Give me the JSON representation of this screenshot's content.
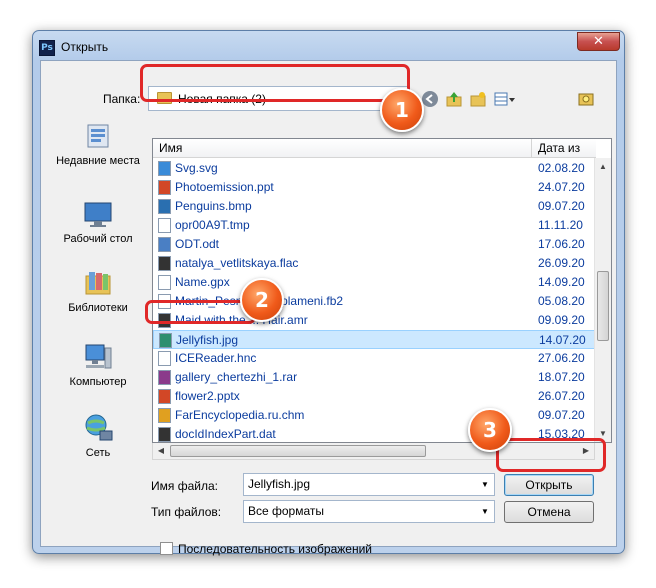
{
  "window": {
    "title": "Открыть",
    "app_icon": "Ps",
    "close_glyph": "✕"
  },
  "folder": {
    "label": "Папка:",
    "value": "Новая папка (2)"
  },
  "toolbar": {
    "back_icon": "back-icon",
    "up_icon": "up-folder-icon",
    "new_folder_icon": "new-folder-icon",
    "view_icon": "view-menu-icon"
  },
  "places": [
    {
      "label": "Недавние места",
      "icon": "recent-places-icon"
    },
    {
      "label": "Рабочий стол",
      "icon": "desktop-icon"
    },
    {
      "label": "Библиотеки",
      "icon": "libraries-icon"
    },
    {
      "label": "Компьютер",
      "icon": "computer-icon"
    },
    {
      "label": "Сеть",
      "icon": "network-icon"
    }
  ],
  "columns": {
    "name": "Имя",
    "date": "Дата из"
  },
  "files": [
    {
      "name": "Svg.svg",
      "date": "02.08.20",
      "color": "#3a8bd8"
    },
    {
      "name": "Photoemission.ppt",
      "date": "24.07.20",
      "color": "#d24726"
    },
    {
      "name": "Penguins.bmp",
      "date": "09.07.20",
      "color": "#2a6fb0"
    },
    {
      "name": "opr00A9T.tmp",
      "date": "11.11.20",
      "color": "#ffffff"
    },
    {
      "name": "ODT.odt",
      "date": "17.06.20",
      "color": "#4a7fc4"
    },
    {
      "name": "natalya_vetlitskaya.flac",
      "date": "26.09.20",
      "color": "#333333"
    },
    {
      "name": "Name.gpx",
      "date": "14.09.20",
      "color": "#ffffff"
    },
    {
      "name": "Martin_Pesn_lda_i_plameni.fb2",
      "date": "05.08.20",
      "color": "#ffffff"
    },
    {
      "name": "Maid with the ... Hair.amr",
      "date": "09.09.20",
      "color": "#333333"
    },
    {
      "name": "Jellyfish.jpg",
      "date": "14.07.20",
      "color": "#2d8f6f"
    },
    {
      "name": "ICEReader.hnc",
      "date": "27.06.20",
      "color": "#ffffff"
    },
    {
      "name": "gallery_chertezhi_1.rar",
      "date": "18.07.20",
      "color": "#8b3a8b"
    },
    {
      "name": "flower2.pptx",
      "date": "26.07.20",
      "color": "#d24726"
    },
    {
      "name": "FarEncyclopedia.ru.chm",
      "date": "09.07.20",
      "color": "#e0a020"
    },
    {
      "name": "docIdIndexPart.dat",
      "date": "15.03.20",
      "color": "#333333"
    }
  ],
  "selected_file": "Jellyfish.jpg",
  "filename": {
    "label": "Имя файла:",
    "value": "Jellyfish.jpg"
  },
  "filetype": {
    "label": "Тип файлов:",
    "value": "Все форматы"
  },
  "buttons": {
    "open": "Открыть",
    "cancel": "Отмена"
  },
  "sequence": {
    "label": "Последовательность изображений",
    "checked": false
  },
  "callouts": [
    "1",
    "2",
    "3"
  ],
  "accent_color": "#e02828"
}
